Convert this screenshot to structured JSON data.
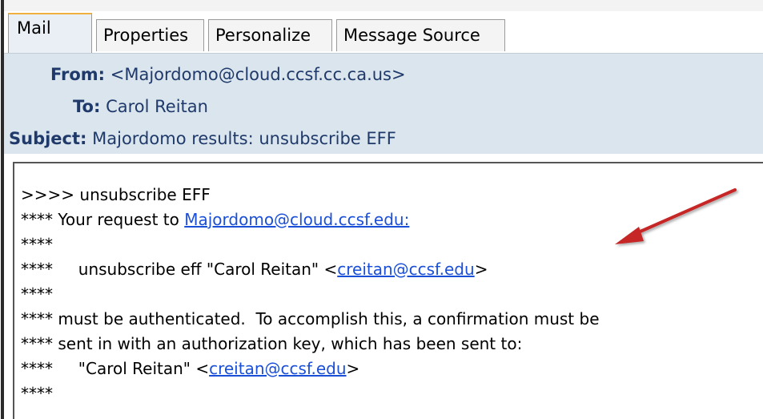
{
  "tabs": [
    {
      "label": "Mail",
      "active": true
    },
    {
      "label": "Properties",
      "active": false
    },
    {
      "label": "Personalize",
      "active": false
    },
    {
      "label": "Message Source",
      "active": false
    }
  ],
  "header": {
    "from_label": "From:",
    "from_value": "<Majordomo@cloud.ccsf.cc.ca.us>",
    "to_label": "To:",
    "to_value": "Carol Reitan",
    "subject_label": "Subject:",
    "subject_value": "Majordomo results: unsubscribe EFF"
  },
  "body": {
    "line1": ">>>> unsubscribe EFF",
    "line2_prefix": "**** Your request to ",
    "line2_link": "Majordomo@cloud.ccsf.edu:",
    "line3": "****",
    "line4_prefix": "****     unsubscribe eff \"Carol Reitan\" <",
    "line4_link": "creitan@ccsf.edu",
    "line4_suffix": ">",
    "line5": "****",
    "line6": "**** must be authenticated.  To accomplish this, a confirmation must be",
    "line7": "**** sent in with an authorization key, which has been sent to:",
    "line8_prefix": "****     \"Carol Reitan\" <",
    "line8_link": "creitan@ccsf.edu",
    "line8_suffix": ">",
    "line9": "****"
  },
  "colors": {
    "header_bg": "#dbe5ee",
    "header_text": "#1f3a6a",
    "link": "#1a4fd8",
    "arrow": "#c62828",
    "active_tab_accent": "#f0b040"
  },
  "icons": {
    "annotation": "red-arrow-icon"
  }
}
